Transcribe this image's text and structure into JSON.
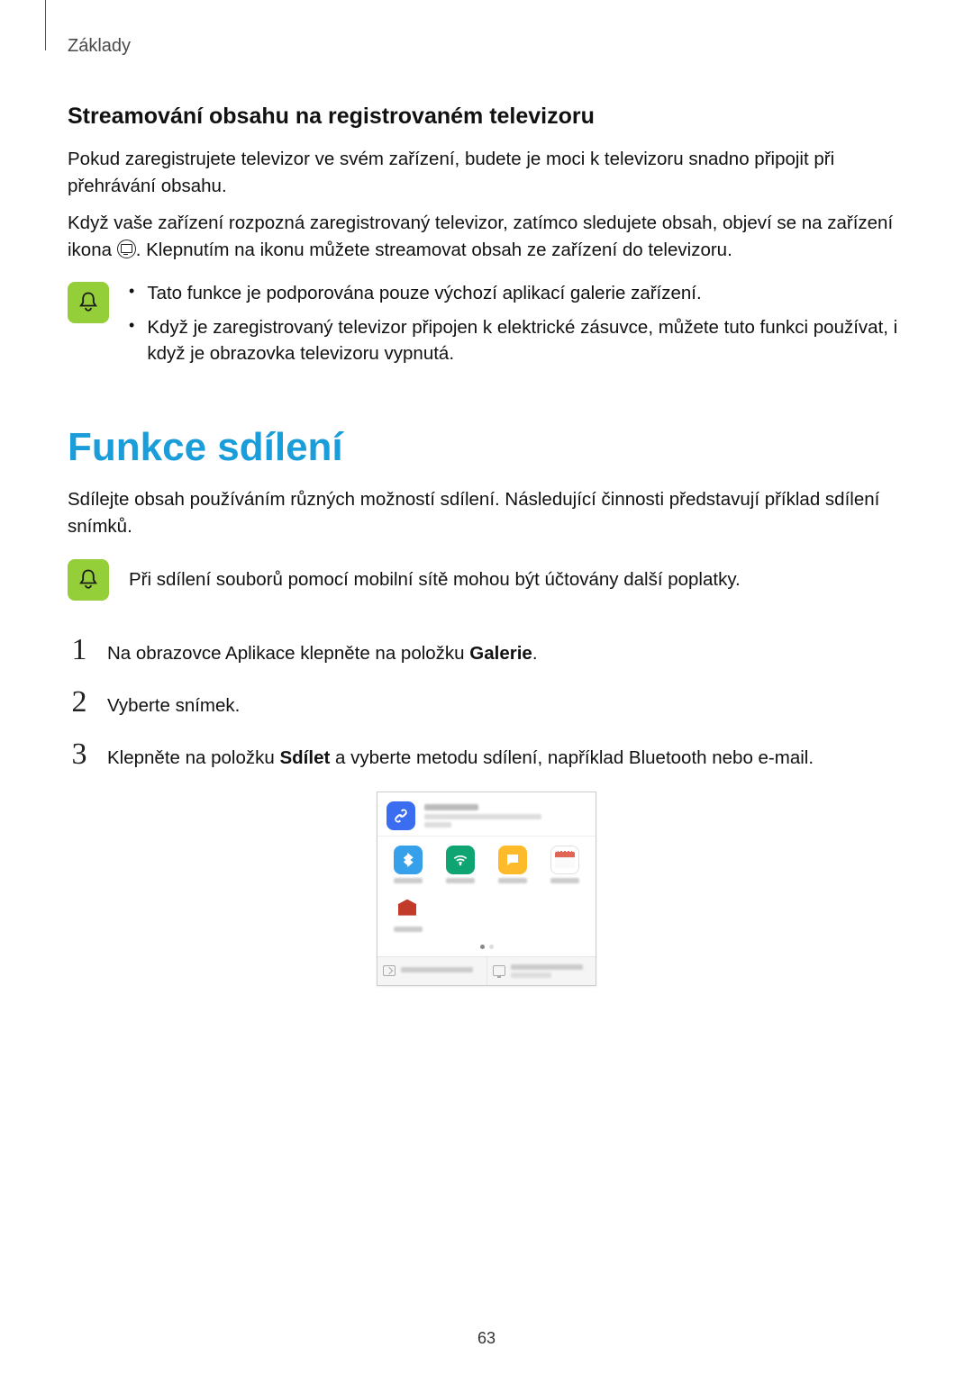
{
  "header": "Základy",
  "section1": {
    "heading": "Streamování obsahu na registrovaném televizoru",
    "p1": "Pokud zaregistrujete televizor ve svém zařízení, budete je moci k televizoru snadno připojit při přehrávání obsahu.",
    "p2a": "Když vaše zařízení rozpozná zaregistrovaný televizor, zatímco sledujete obsah, objeví se na zařízení ikona ",
    "p2b": ". Klepnutím na ikonu můžete streamovat obsah ze zařízení do televizoru.",
    "note_bullets": [
      "Tato funkce je podporována pouze výchozí aplikací galerie zařízení.",
      "Když je zaregistrovaný televizor připojen k elektrické zásuvce, můžete tuto funkci používat, i když je obrazovka televizoru vypnutá."
    ]
  },
  "section2": {
    "h1": "Funkce sdílení",
    "p1": "Sdílejte obsah používáním různých možností sdílení. Následující činnosti představují příklad sdílení snímků.",
    "note": "Při sdílení souborů pomocí mobilní sítě mohou být účtovány další poplatky.",
    "steps": [
      {
        "num": "1",
        "pre": "Na obrazovce Aplikace klepněte na položku ",
        "bold": "Galerie",
        "post": "."
      },
      {
        "num": "2",
        "pre": "Vyberte snímek.",
        "bold": "",
        "post": ""
      },
      {
        "num": "3",
        "pre": "Klepněte na položku ",
        "bold": "Sdílet",
        "post": " a vyberte metodu sdílení, například Bluetooth nebo e-mail."
      }
    ]
  },
  "pagenum": "63"
}
